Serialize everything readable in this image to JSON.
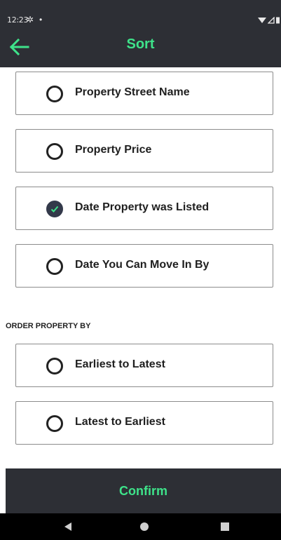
{
  "status_bar": {
    "time": "12:23"
  },
  "app_bar": {
    "title": "Sort"
  },
  "sort_options": [
    {
      "label": "Property Street Name",
      "selected": false
    },
    {
      "label": "Property Price",
      "selected": false
    },
    {
      "label": "Date Property was Listed",
      "selected": true
    },
    {
      "label": "Date You Can Move In By",
      "selected": false
    }
  ],
  "order_section": {
    "header": "ORDER PROPERTY BY",
    "options": [
      {
        "label": "Earliest to Latest",
        "selected": false
      },
      {
        "label": "Latest to Earliest",
        "selected": false
      }
    ]
  },
  "confirm": {
    "label": "Confirm"
  },
  "colors": {
    "accent": "#3ee38a",
    "bar": "#2d2f35",
    "radio_checked": "#33394a"
  }
}
